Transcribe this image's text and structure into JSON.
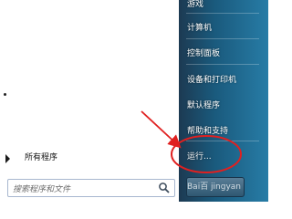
{
  "start_menu": {
    "right_items": [
      {
        "label": "游戏"
      },
      {
        "label": "计算机"
      },
      {
        "label": "控制面板"
      },
      {
        "label": "设备和打印机"
      },
      {
        "label": "默认程序"
      },
      {
        "label": "帮助和支持"
      },
      {
        "label": "运行..."
      }
    ],
    "all_programs_label": "所有程序",
    "search_placeholder": "搜索程序和文件",
    "watermark": "Bai百 jingyan"
  },
  "colors": {
    "right_pane": "#1a5a7d",
    "annotation_red": "#e02020"
  },
  "icons": {
    "search": "search-icon",
    "all_programs": "triangle-right-icon"
  }
}
